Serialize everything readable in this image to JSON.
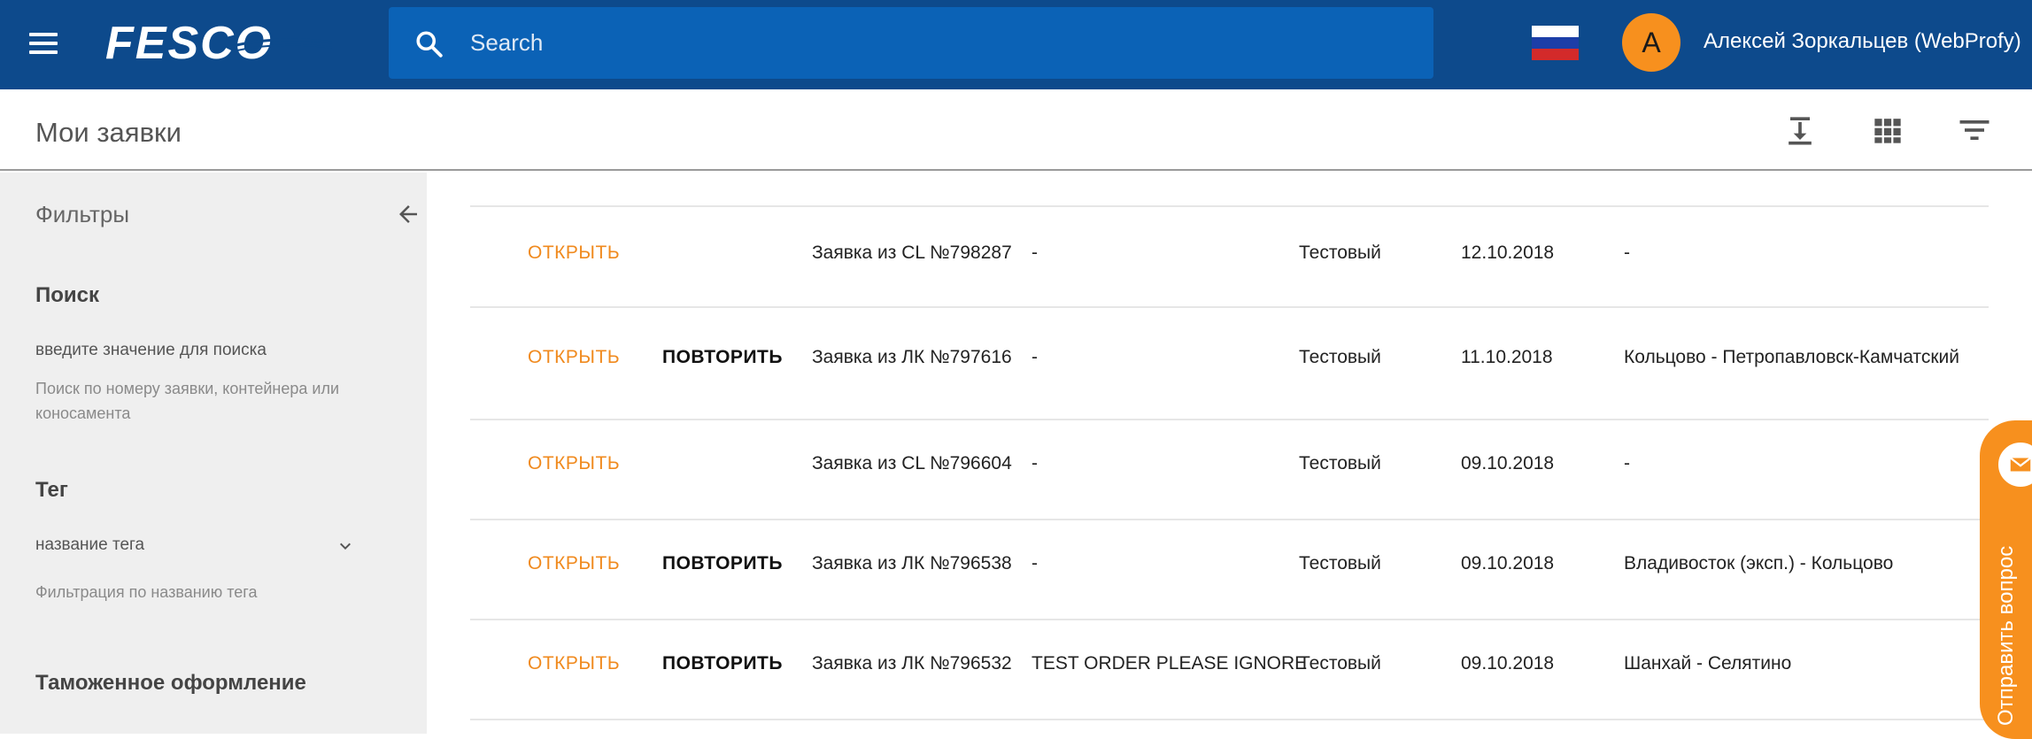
{
  "topbar": {
    "logo_text": "FESCO",
    "search_placeholder": "Search",
    "user_initial": "A",
    "user_name": "Алексей Зоркальцев (WebProfy)",
    "colors": {
      "bar": "#0d4a8c",
      "search": "#0b62b6",
      "avatar": "#f7901e"
    }
  },
  "header": {
    "title": "Мои заявки",
    "icons": [
      "download-icon",
      "grid-view-icon",
      "filter-list-icon"
    ]
  },
  "sidebar": {
    "title": "Фильтры",
    "search": {
      "heading": "Поиск",
      "label": "введите значение для поиска",
      "hint": "Поиск по номеру заявки, контейнера или коносамента"
    },
    "tag": {
      "heading": "Тег",
      "label": "название тега",
      "hint": "Фильтрация по названию тега"
    },
    "customs": {
      "heading": "Таможенное оформление"
    }
  },
  "table": {
    "open_label": "ОТКРЫТЬ",
    "repeat_label": "ПОВТОРИТЬ",
    "rows": [
      {
        "name": "Заявка из CL №798287",
        "comment": "-",
        "status": "Тестовый",
        "date": "12.10.2018",
        "route": "-",
        "repeat": false
      },
      {
        "name": "Заявка из ЛК №797616",
        "comment": "-",
        "status": "Тестовый",
        "date": "11.10.2018",
        "route": "Кольцово - Петропавловск-Камчатский",
        "repeat": true
      },
      {
        "name": "Заявка из CL №796604",
        "comment": "-",
        "status": "Тестовый",
        "date": "09.10.2018",
        "route": "-",
        "repeat": false
      },
      {
        "name": "Заявка из ЛК №796538",
        "comment": "-",
        "status": "Тестовый",
        "date": "09.10.2018",
        "route": "Владивосток (эксп.) - Кольцово",
        "repeat": true
      },
      {
        "name": "Заявка из ЛК №796532",
        "comment": "TEST ORDER PLEASE IGNORE",
        "status": "Тестовый",
        "date": "09.10.2018",
        "route": "Шанхай - Селятино",
        "repeat": true
      }
    ]
  },
  "feedback": {
    "label": "Отправить вопрос",
    "icon": "mail-icon"
  }
}
